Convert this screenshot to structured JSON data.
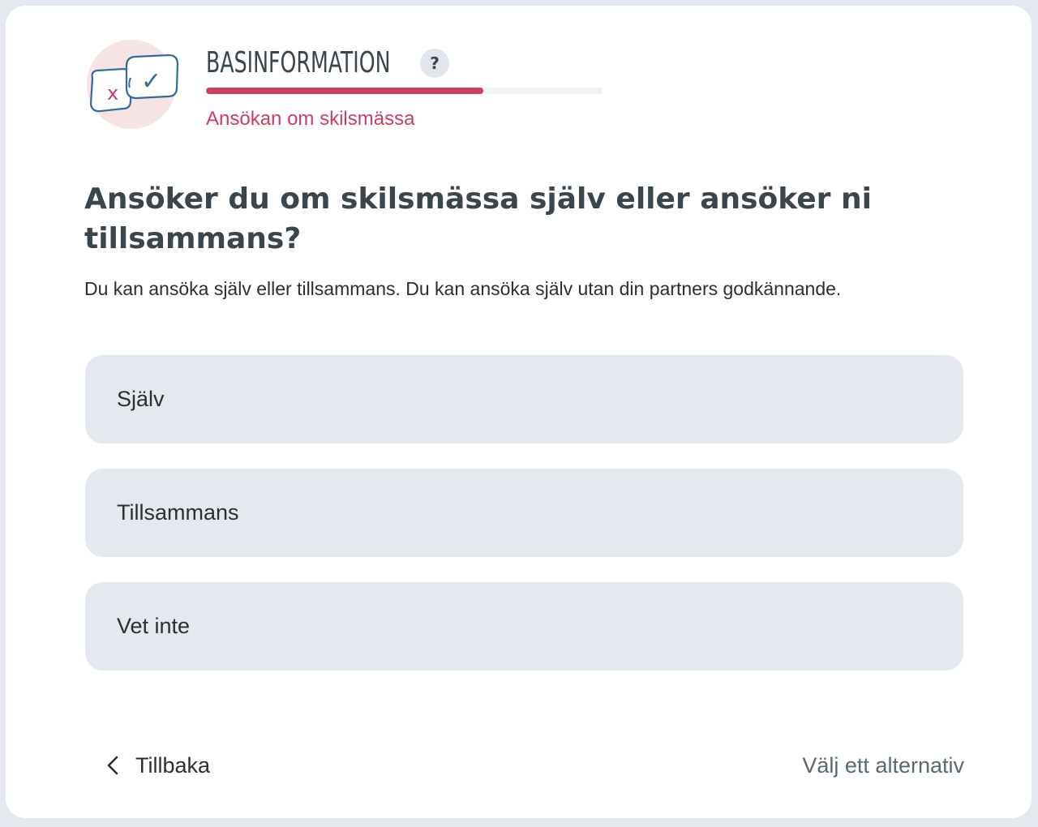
{
  "header": {
    "section_title": "BASINFORMATION",
    "help_label": "?",
    "progress": 0.7,
    "subtitle": "Ansökan om skilsmässa",
    "icon_cross": "x",
    "icon_check": "✓"
  },
  "main": {
    "question": "Ansöker du om skilsmässa själv eller ansöker ni tillsammans?",
    "description": "Du kan ansöka själv eller tillsammans. Du kan ansöka själv utan din partners godkännande.",
    "options": [
      {
        "label": "Själv"
      },
      {
        "label": "Tillsammans"
      },
      {
        "label": "Vet inte"
      }
    ]
  },
  "footer": {
    "back_label": "Tillbaka",
    "status_hint": "Välj ett alternativ"
  },
  "colors": {
    "accent": "#cc3d62",
    "icon_blue": "#2f6d9e",
    "icon_circle": "#f6e3e3",
    "option_bg": "#e3e9ef",
    "title_text": "#3a454c"
  },
  "icons": {
    "header_icon": "cross-and-check-bubbles-icon",
    "help_icon": "question-mark-icon",
    "back_icon": "chevron-left-icon"
  }
}
